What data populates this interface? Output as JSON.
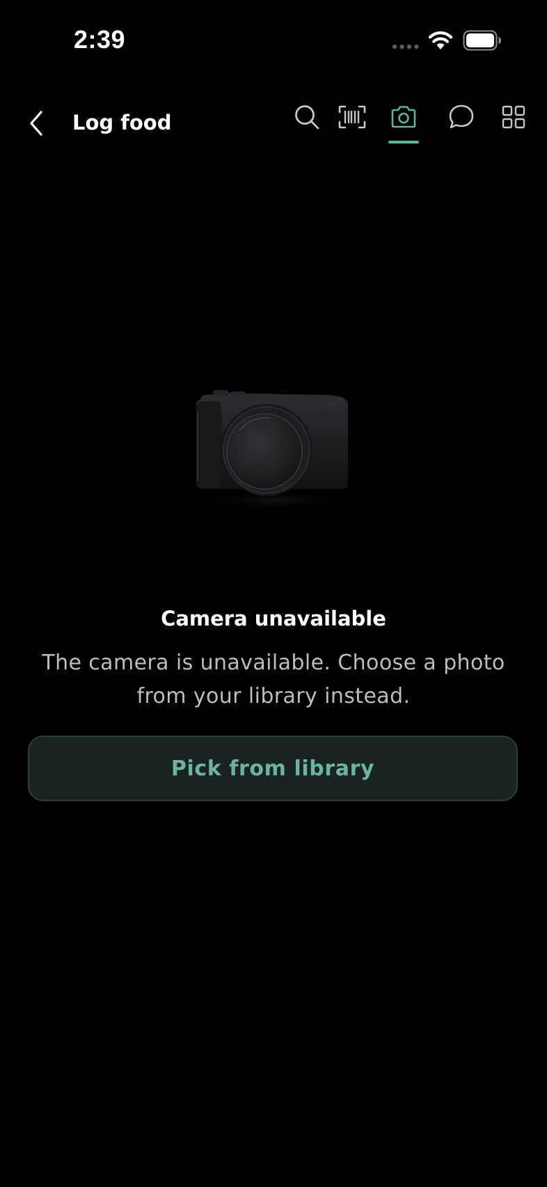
{
  "status_bar": {
    "time": "2:39",
    "icons": [
      "signal-dots-icon",
      "wifi-icon",
      "battery-icon"
    ]
  },
  "header": {
    "back_icon": "chevron-left-icon",
    "title": "Log food",
    "tabs": [
      {
        "icon": "search-icon",
        "active": false
      },
      {
        "icon": "barcode-icon",
        "active": false
      },
      {
        "icon": "camera-icon",
        "active": true
      },
      {
        "icon": "chat-bubble-icon",
        "active": false
      },
      {
        "icon": "grid-icon",
        "active": false
      }
    ]
  },
  "main": {
    "illustration": "camera-illustration",
    "title": "Camera unavailable",
    "body": "The camera is unavailable. Choose a photo from your library instead.",
    "button_label": "Pick from library"
  },
  "colors": {
    "background": "#000000",
    "accent": "#5fb3a2",
    "button_background": "#192321",
    "button_border": "#2a3f3a",
    "body_text": "#bdbdbd",
    "icon": "#c8c8c8"
  }
}
